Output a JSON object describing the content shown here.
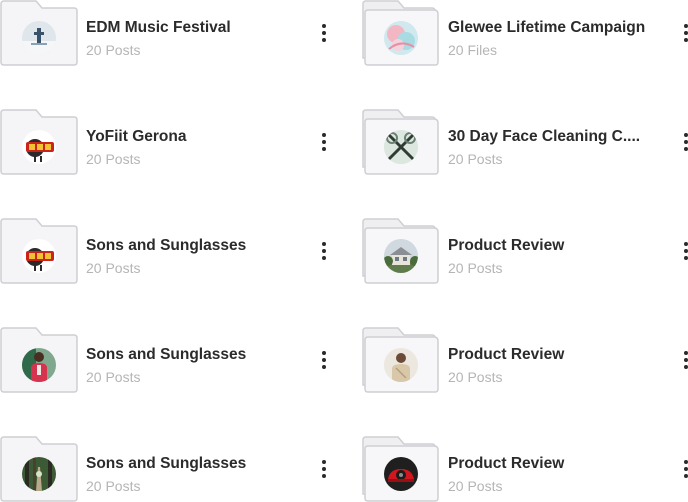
{
  "folders": [
    {
      "title": "EDM Music Festival",
      "meta": "20 Posts",
      "thumb": "snow-tower-icon",
      "folder": "single"
    },
    {
      "title": "Glewee Lifetime Campaign",
      "meta": "20 Files",
      "thumb": "pastel-art-icon",
      "folder": "stacked"
    },
    {
      "title": "YoFiit Gerona",
      "meta": "20 Posts",
      "thumb": "bbq-logo-icon",
      "folder": "single"
    },
    {
      "title": "30 Day Face Cleaning C....",
      "meta": "20 Posts",
      "thumb": "crossed-rackets-icon",
      "folder": "stacked"
    },
    {
      "title": "Sons and Sunglasses",
      "meta": "20 Posts",
      "thumb": "bbq-logo-icon",
      "folder": "single"
    },
    {
      "title": "Product Review",
      "meta": "20 Posts",
      "thumb": "house-icon",
      "folder": "stacked"
    },
    {
      "title": "Sons and Sunglasses",
      "meta": "20 Posts",
      "thumb": "person-red-jacket-icon",
      "folder": "single"
    },
    {
      "title": "Product Review",
      "meta": "20 Posts",
      "thumb": "person-beige-icon",
      "folder": "stacked"
    },
    {
      "title": "Sons and Sunglasses",
      "meta": "20 Posts",
      "thumb": "forest-path-icon",
      "folder": "single"
    },
    {
      "title": "Product Review",
      "meta": "20 Posts",
      "thumb": "red-car-icon",
      "folder": "stacked"
    }
  ]
}
